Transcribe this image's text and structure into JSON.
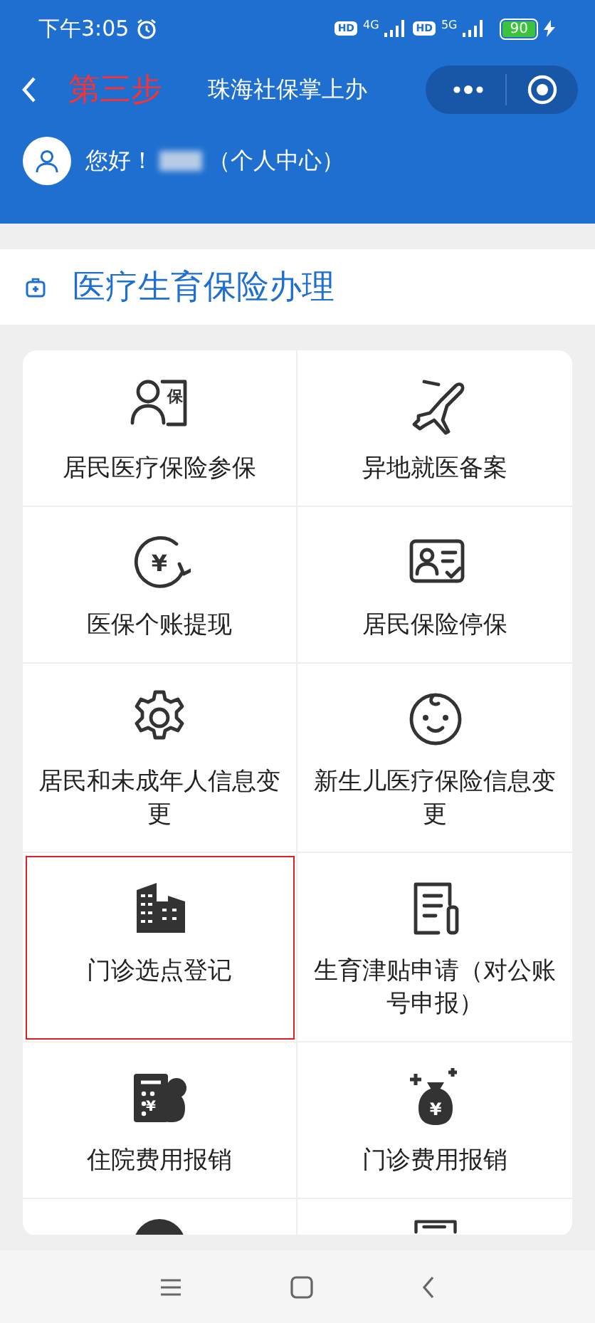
{
  "status_bar": {
    "time": "下午3:05",
    "network_badges": [
      "HD",
      "HD"
    ],
    "network_types": [
      "4G",
      "5G"
    ],
    "battery": "90",
    "charging": true
  },
  "nav_bar": {
    "title": "珠海社保掌上办",
    "annotation": "第三步"
  },
  "user": {
    "greeting": "您好！",
    "name_blurred": true,
    "link": "（个人中心）"
  },
  "section": {
    "title": "医疗生育保险办理"
  },
  "services": [
    {
      "kind": "service",
      "label": "居民医疗保险参保",
      "icon_text": "保",
      "highlighted": false
    },
    {
      "kind": "service",
      "label": "异地就医备案",
      "highlighted": false
    },
    {
      "kind": "service",
      "label": "医保个账提现",
      "icon_text": "¥",
      "highlighted": false
    },
    {
      "kind": "service",
      "label": "居民保险停保",
      "highlighted": false
    },
    {
      "kind": "service",
      "label": "居民和未成年人信息变更",
      "highlighted": false
    },
    {
      "kind": "service",
      "label": "新生儿医疗保险信息变更",
      "highlighted": false
    },
    {
      "kind": "service",
      "label": "门诊选点登记",
      "highlighted": true
    },
    {
      "kind": "service",
      "label": "生育津贴申请（对公账号申报）",
      "highlighted": false
    },
    {
      "kind": "service",
      "label": "住院费用报销",
      "icon_text": "¥",
      "highlighted": false
    },
    {
      "kind": "service",
      "label": "门诊费用报销",
      "icon_text": "¥",
      "highlighted": false
    },
    {
      "kind": "cut-off"
    },
    {
      "kind": "cut-off"
    }
  ]
}
